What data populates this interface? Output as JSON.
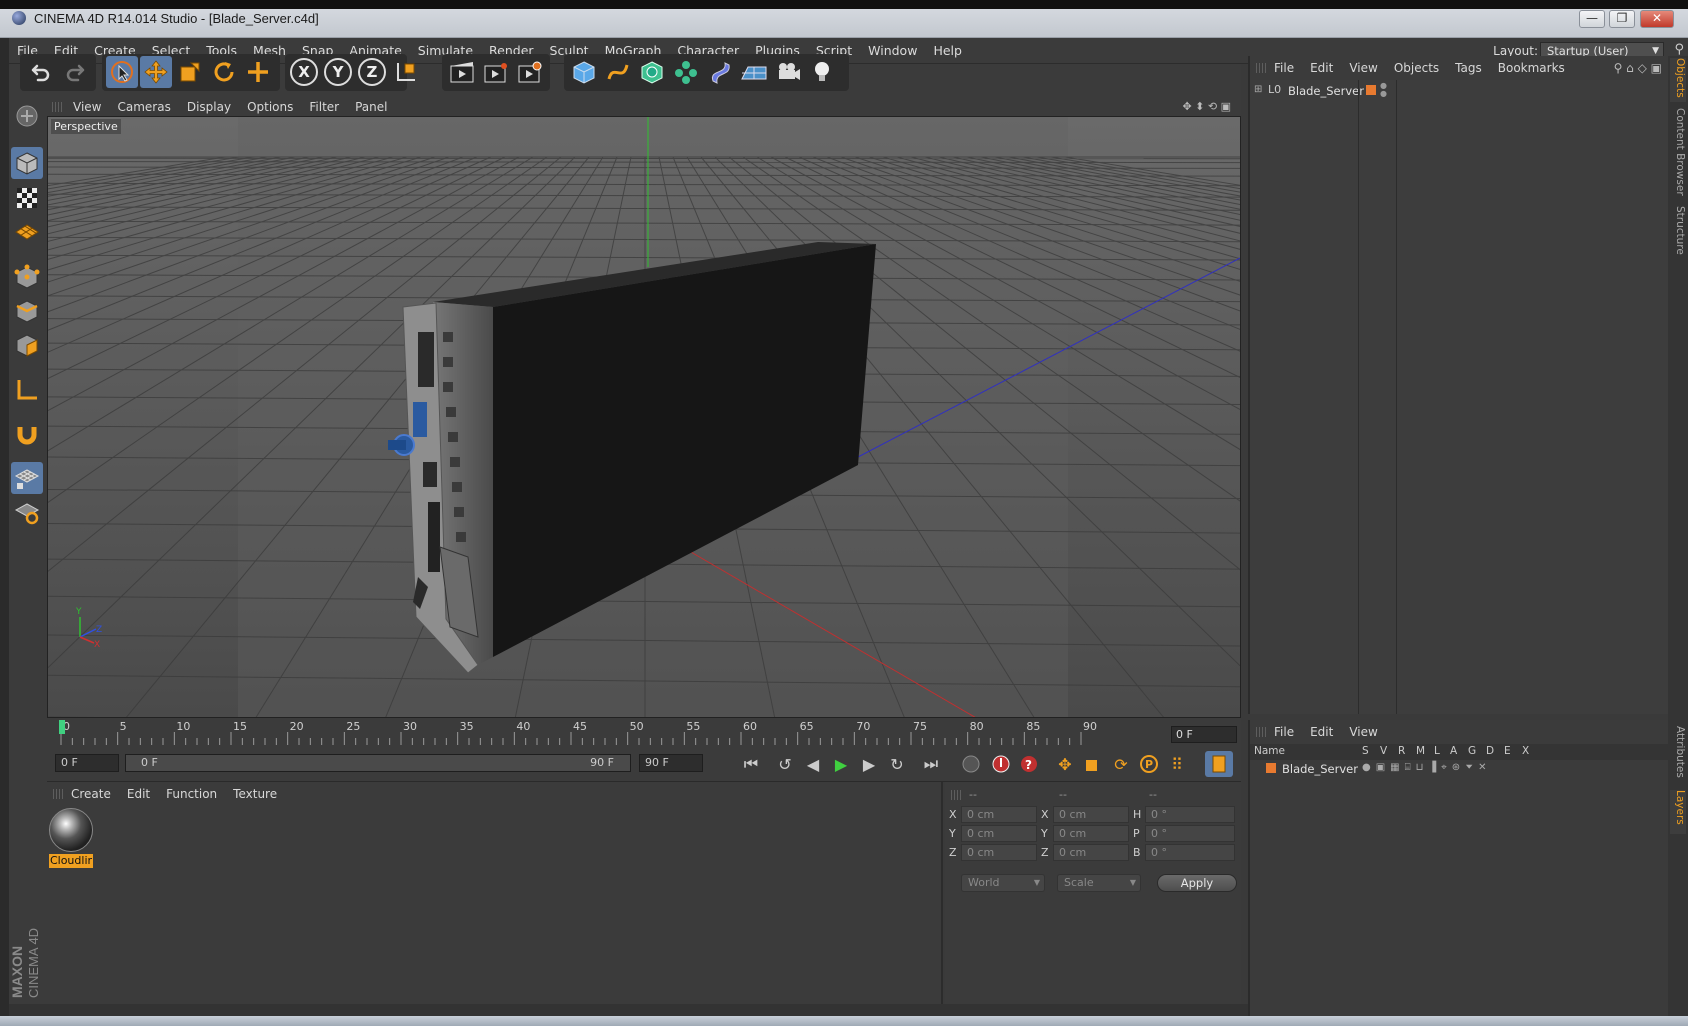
{
  "window": {
    "title": "CINEMA 4D R14.014 Studio - [Blade_Server.c4d]",
    "minimize": "—",
    "restore": "❐",
    "close": "✕"
  },
  "menubar": {
    "items": [
      "File",
      "Edit",
      "Create",
      "Select",
      "Tools",
      "Mesh",
      "Snap",
      "Animate",
      "Simulate",
      "Render",
      "Sculpt",
      "MoGraph",
      "Character",
      "Plugins",
      "Script",
      "Window",
      "Help"
    ],
    "layout_label": "Layout:",
    "layout_value": "Startup (User)"
  },
  "toolbar": {
    "axis": [
      "X",
      "Y",
      "Z"
    ]
  },
  "viewport": {
    "menu": [
      "View",
      "Cameras",
      "Display",
      "Options",
      "Filter",
      "Panel"
    ],
    "camera_label": "Perspective",
    "axis_labels": {
      "y": "Y",
      "x": "X",
      "z": "Z"
    }
  },
  "timeline": {
    "ticks": [
      "0",
      "5",
      "10",
      "15",
      "20",
      "25",
      "30",
      "35",
      "40",
      "45",
      "50",
      "55",
      "60",
      "65",
      "70",
      "75",
      "80",
      "85",
      "90"
    ],
    "current_frame": "0 F"
  },
  "transport": {
    "start_field": "0 F",
    "range_start": "0 F",
    "range_end": "90 F",
    "end_field": "90 F"
  },
  "materials": {
    "menu": [
      "Create",
      "Edit",
      "Function",
      "Texture"
    ],
    "items": [
      {
        "name": "Cloudlir"
      }
    ]
  },
  "coordinates": {
    "header": [
      "--",
      "--",
      "--"
    ],
    "rows": [
      {
        "l1": "X",
        "v1": "0 cm",
        "l2": "X",
        "v2": "0 cm",
        "l3": "H",
        "v3": "0 °"
      },
      {
        "l1": "Y",
        "v1": "0 cm",
        "l2": "Y",
        "v2": "0 cm",
        "l3": "P",
        "v3": "0 °"
      },
      {
        "l1": "Z",
        "v1": "0 cm",
        "l2": "Z",
        "v2": "0 cm",
        "l3": "B",
        "v3": "0 °"
      }
    ],
    "mode_world": "World",
    "mode_scale": "Scale",
    "apply": "Apply"
  },
  "objects": {
    "menu": [
      "File",
      "Edit",
      "View",
      "Objects",
      "Tags",
      "Bookmarks"
    ],
    "items": [
      {
        "name": "Blade_Server",
        "color": "#e87a30"
      }
    ]
  },
  "layers": {
    "menu": [
      "File",
      "Edit",
      "View"
    ],
    "columns": [
      "Name",
      "S",
      "V",
      "R",
      "M",
      "L",
      "A",
      "G",
      "D",
      "E",
      "X"
    ],
    "items": [
      {
        "name": "Blade_Server",
        "color": "#e87a30"
      }
    ]
  },
  "side_tabs": [
    "Objects",
    "Content Browser",
    "Structure",
    "Attributes",
    "Layers"
  ],
  "branding": {
    "brand": "MAXON",
    "product": "CINEMA 4D"
  },
  "colors": {
    "accent": "#f0a020",
    "selected_tool": "#5a7aa5",
    "x_axis": "#c03030",
    "y_axis": "#30c030",
    "z_axis": "#3030c0"
  }
}
